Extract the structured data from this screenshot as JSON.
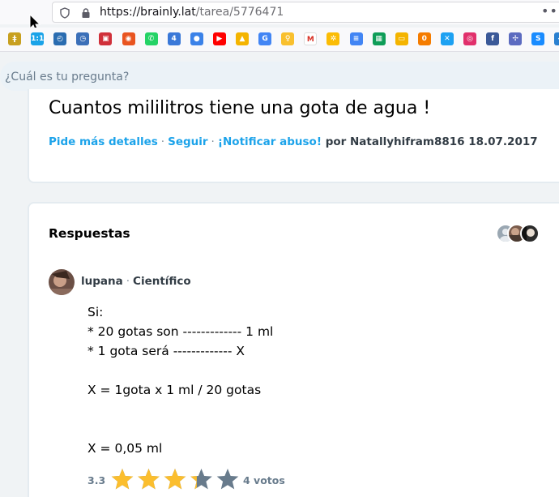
{
  "browser": {
    "url_host": "https://brainly.lat",
    "url_path": "/tarea/5776471",
    "bookmarks": [
      {
        "icon": "candle-icon",
        "color": "#c8a020",
        "glyph": "ǂ"
      },
      {
        "icon": "calendar-1-1-icon",
        "color": "#1aa3e8",
        "glyph": "1:1"
      },
      {
        "icon": "speedtest-icon",
        "color": "#2a6cb0",
        "glyph": "◴"
      },
      {
        "icon": "speedometer-icon",
        "color": "#3b6fb8",
        "glyph": "◷"
      },
      {
        "icon": "red-app-icon",
        "color": "#d0303a",
        "glyph": "▣"
      },
      {
        "icon": "ubuntu-icon",
        "color": "#e95420",
        "glyph": "◉"
      },
      {
        "icon": "whatsapp-icon",
        "color": "#25d366",
        "glyph": "✆"
      },
      {
        "icon": "calendar-4-icon",
        "color": "#3a78d8",
        "glyph": "4"
      },
      {
        "icon": "contacts-icon",
        "color": "#3b82e8",
        "glyph": "●"
      },
      {
        "icon": "youtube-icon",
        "color": "#ff0000",
        "glyph": "▶"
      },
      {
        "icon": "google-drive-icon",
        "color": "#f4b400",
        "glyph": "▲"
      },
      {
        "icon": "google-translate-icon",
        "color": "#4285f4",
        "glyph": "G"
      },
      {
        "icon": "keep-icon",
        "color": "#f9c02e",
        "glyph": "♀"
      },
      {
        "icon": "gmail-icon",
        "color": "#ffffff",
        "glyph": "M"
      },
      {
        "icon": "photos-icon",
        "color": "#fbbc05",
        "glyph": "✲"
      },
      {
        "icon": "docs-icon",
        "color": "#4285f4",
        "glyph": "≡"
      },
      {
        "icon": "sheets-icon",
        "color": "#0f9d58",
        "glyph": "▦"
      },
      {
        "icon": "slides-icon",
        "color": "#f4b400",
        "glyph": "▭"
      },
      {
        "icon": "orange-app-icon",
        "color": "#f57c00",
        "glyph": "0"
      },
      {
        "icon": "twitter-icon",
        "color": "#1da1f2",
        "glyph": "✕"
      },
      {
        "icon": "instagram-icon",
        "color": "#e1306c",
        "glyph": "◎"
      },
      {
        "icon": "facebook-icon",
        "color": "#3b5998",
        "glyph": "f"
      },
      {
        "icon": "grid-app-icon",
        "color": "#5c6bc0",
        "glyph": "✢"
      },
      {
        "icon": "shazam-icon",
        "color": "#1a8cff",
        "glyph": "S"
      },
      {
        "icon": "blue-app-icon",
        "color": "#2a80d0",
        "glyph": "◆"
      }
    ]
  },
  "search": {
    "placeholder": "¿Cuál es tu pregunta?"
  },
  "question": {
    "text": "Cuantos mililitros tiene una gota de agua !",
    "actions": {
      "details": "Pide más detalles",
      "follow": "Seguir",
      "report": "¡Notificar abuso!",
      "by": "por Natallyhifram8816 18.07.2017"
    }
  },
  "answers": {
    "title": "Respuestas",
    "answer": {
      "user": "lupana",
      "rank": "Científico",
      "body": "Si:\n* 20 gotas son ------------- 1 ml\n* 1 gota será ------------- X\n\nX = 1gota x 1 ml / 20 gotas\n\n\nX = 0,05 ml",
      "rating": {
        "score": "3.3",
        "value": 3.3,
        "max": 5,
        "votes": "4 votos"
      }
    }
  },
  "colors": {
    "link": "#1ca3ea",
    "star_filled": "#fbbe2e",
    "star_empty": "#687b8c"
  }
}
